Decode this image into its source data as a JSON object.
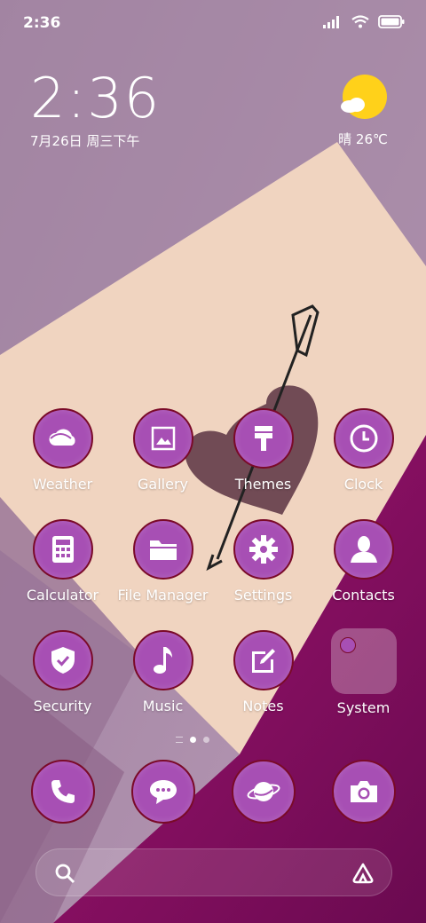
{
  "status_bar": {
    "time": "2:36"
  },
  "clock_widget": {
    "time": "2:36",
    "date": "7月26日 周三下午"
  },
  "weather_widget": {
    "text": "晴 26℃"
  },
  "apps": [
    {
      "label": "Weather",
      "icon": "weather-cloud-icon"
    },
    {
      "label": "Gallery",
      "icon": "gallery-image-icon"
    },
    {
      "label": "Themes",
      "icon": "paintbrush-icon"
    },
    {
      "label": "Clock",
      "icon": "clock-icon"
    },
    {
      "label": "Calculator",
      "icon": "calculator-icon"
    },
    {
      "label": "File Manager",
      "icon": "folder-icon"
    },
    {
      "label": "Settings",
      "icon": "gear-icon"
    },
    {
      "label": "Contacts",
      "icon": "person-icon"
    },
    {
      "label": "Security",
      "icon": "shield-check-icon"
    },
    {
      "label": "Music",
      "icon": "music-note-icon"
    },
    {
      "label": "Notes",
      "icon": "note-edit-icon"
    },
    {
      "label": "System",
      "icon": "folder-group-icon"
    }
  ],
  "dock": [
    "phone-icon",
    "message-icon",
    "browser-planet-icon",
    "camera-icon"
  ],
  "colors": {
    "icon_fill": "#a74fb4",
    "icon_border": "#7a0a28"
  }
}
